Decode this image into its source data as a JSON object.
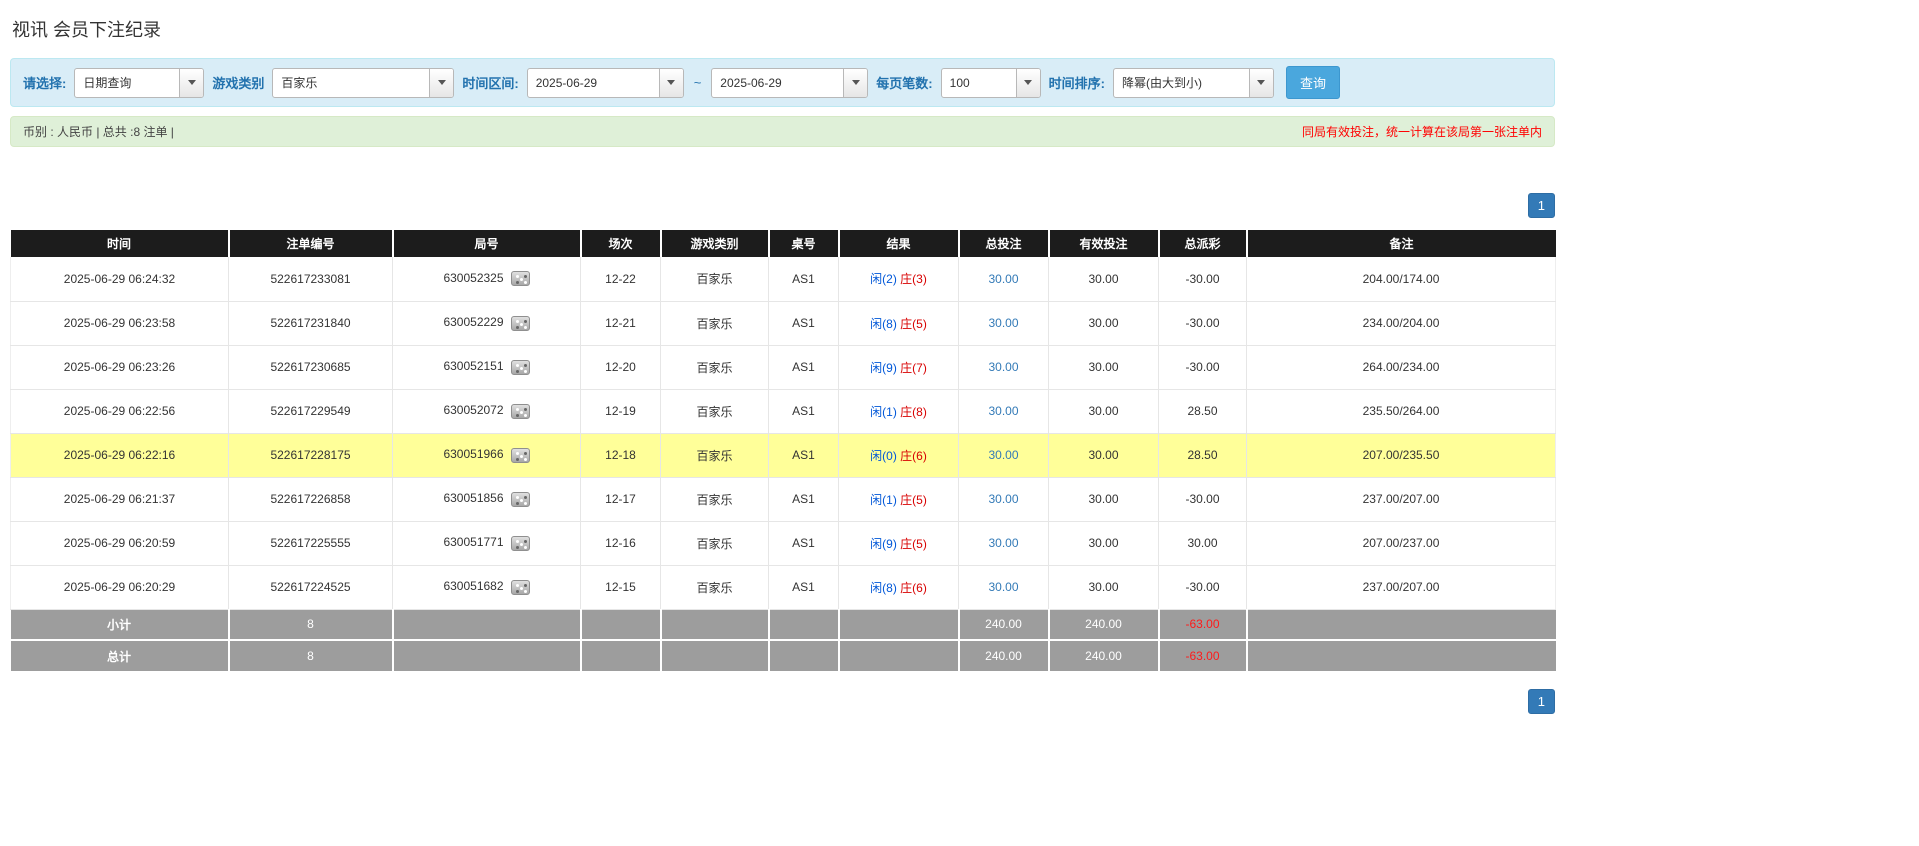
{
  "page": {
    "title": "视讯 会员下注纪录"
  },
  "filter": {
    "query_type": {
      "label": "请选择:",
      "value": "日期查询"
    },
    "game_type": {
      "label": "游戏类别",
      "value": "百家乐"
    },
    "time_range": {
      "label": "时间区间:",
      "from": "2025-06-29",
      "separator": "~",
      "to": "2025-06-29"
    },
    "page_size": {
      "label": "每页笔数:",
      "value": "100"
    },
    "sort": {
      "label": "时间排序:",
      "value": "降幂(由大到小)"
    },
    "search_button": "查询"
  },
  "info_bar": {
    "summary": "币别 : 人民币 | 总共 :8 注单 |",
    "notice": "同局有效投注，统一计算在该局第一张注单内"
  },
  "pagination": {
    "current_page": "1"
  },
  "table": {
    "headers": [
      "时间",
      "注单编号",
      "局号",
      "场次",
      "游戏类别",
      "桌号",
      "结果",
      "总投注",
      "有效投注",
      "总派彩",
      "备注"
    ],
    "rows": [
      {
        "time": "2025-06-29 06:24:32",
        "bet_no": "522617233081",
        "round_no": "630052325",
        "session": "12-22",
        "game": "百家乐",
        "table_no": "AS1",
        "result_player": "闲(2)",
        "result_banker": "庄(3)",
        "total_bet": "30.00",
        "valid_bet": "30.00",
        "payout": "-30.00",
        "remark": "204.00/174.00",
        "highlight": false
      },
      {
        "time": "2025-06-29 06:23:58",
        "bet_no": "522617231840",
        "round_no": "630052229",
        "session": "12-21",
        "game": "百家乐",
        "table_no": "AS1",
        "result_player": "闲(8)",
        "result_banker": "庄(5)",
        "total_bet": "30.00",
        "valid_bet": "30.00",
        "payout": "-30.00",
        "remark": "234.00/204.00",
        "highlight": false
      },
      {
        "time": "2025-06-29 06:23:26",
        "bet_no": "522617230685",
        "round_no": "630052151",
        "session": "12-20",
        "game": "百家乐",
        "table_no": "AS1",
        "result_player": "闲(9)",
        "result_banker": "庄(7)",
        "total_bet": "30.00",
        "valid_bet": "30.00",
        "payout": "-30.00",
        "remark": "264.00/234.00",
        "highlight": false
      },
      {
        "time": "2025-06-29 06:22:56",
        "bet_no": "522617229549",
        "round_no": "630052072",
        "session": "12-19",
        "game": "百家乐",
        "table_no": "AS1",
        "result_player": "闲(1)",
        "result_banker": "庄(8)",
        "total_bet": "30.00",
        "valid_bet": "30.00",
        "payout": "28.50",
        "remark": "235.50/264.00",
        "highlight": false
      },
      {
        "time": "2025-06-29 06:22:16",
        "bet_no": "522617228175",
        "round_no": "630051966",
        "session": "12-18",
        "game": "百家乐",
        "table_no": "AS1",
        "result_player": "闲(0)",
        "result_banker": "庄(6)",
        "total_bet": "30.00",
        "valid_bet": "30.00",
        "payout": "28.50",
        "remark": "207.00/235.50",
        "highlight": true
      },
      {
        "time": "2025-06-29 06:21:37",
        "bet_no": "522617226858",
        "round_no": "630051856",
        "session": "12-17",
        "game": "百家乐",
        "table_no": "AS1",
        "result_player": "闲(1)",
        "result_banker": "庄(5)",
        "total_bet": "30.00",
        "valid_bet": "30.00",
        "payout": "-30.00",
        "remark": "237.00/207.00",
        "highlight": false
      },
      {
        "time": "2025-06-29 06:20:59",
        "bet_no": "522617225555",
        "round_no": "630051771",
        "session": "12-16",
        "game": "百家乐",
        "table_no": "AS1",
        "result_player": "闲(9)",
        "result_banker": "庄(5)",
        "total_bet": "30.00",
        "valid_bet": "30.00",
        "payout": "30.00",
        "remark": "207.00/237.00",
        "highlight": false
      },
      {
        "time": "2025-06-29 06:20:29",
        "bet_no": "522617224525",
        "round_no": "630051682",
        "session": "12-15",
        "game": "百家乐",
        "table_no": "AS1",
        "result_player": "闲(8)",
        "result_banker": "庄(6)",
        "total_bet": "30.00",
        "valid_bet": "30.00",
        "payout": "-30.00",
        "remark": "237.00/207.00",
        "highlight": false
      }
    ],
    "subtotal": {
      "label": "小计",
      "count": "8",
      "total_bet": "240.00",
      "valid_bet": "240.00",
      "payout": "-63.00"
    },
    "grand_total": {
      "label": "总计",
      "count": "8",
      "total_bet": "240.00",
      "valid_bet": "240.00",
      "payout": "-63.00"
    }
  },
  "icons": {
    "round_result": "dice-icon",
    "dropdown": "caret-down-icon"
  },
  "colors": {
    "header_bg": "#1c1c1c",
    "highlight_row": "#ffff99",
    "footer_bg": "#9d9d9d",
    "link_blue": "#337ab7",
    "negative_red": "#e60000",
    "player_blue": "#0057d8",
    "banker_red": "#d80000",
    "filter_bar_bg": "#d9edf7",
    "filter_label_blue": "#2272ae",
    "info_bar_bg": "#dff0d8",
    "notice_red": "#ff0000",
    "search_button_blue": "#4aa7dd",
    "pagination_blue": "#337ab7"
  }
}
